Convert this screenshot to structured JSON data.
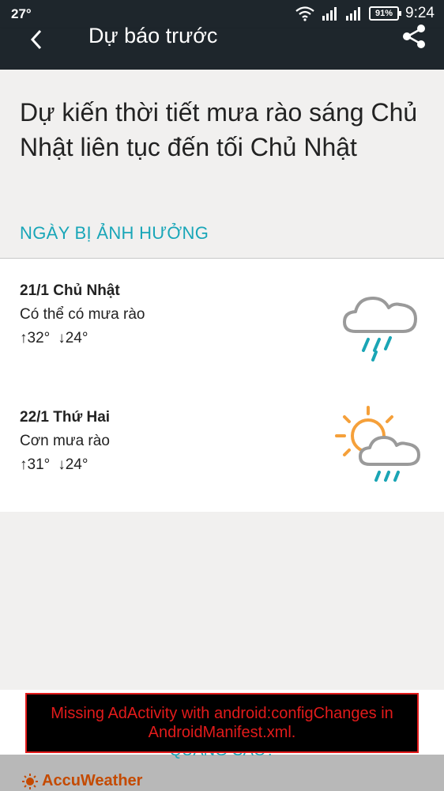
{
  "status_bar": {
    "temperature": "27°",
    "battery": "91%",
    "time": "9:24"
  },
  "app_bar": {
    "title": "Dự báo trước"
  },
  "alert": {
    "headline": "Dự kiến thời tiết mưa rào sáng Chủ Nhật liên tục đến tối Chủ Nhật",
    "section_label": "NGÀY BỊ ẢNH HƯỞNG"
  },
  "days": [
    {
      "date": "21/1 Chủ Nhật",
      "condition": "Có thể có mưa rào",
      "high": "↑32°",
      "low": "↓24°",
      "icon": "cloud-rain-icon"
    },
    {
      "date": "22/1 Thứ Hai",
      "condition": "Cơn mưa rào",
      "high": "↑31°",
      "low": "↓24°",
      "icon": "sun-cloud-rain-icon"
    }
  ],
  "ad": {
    "error_message": "Missing AdActivity with android:configChanges in AndroidManifest.xml.",
    "question": "QUẢNG CÁO?",
    "brand": "AccuWeather"
  },
  "colors": {
    "accent": "#19a6b8",
    "appbar": "#1e262c",
    "error": "#e21b1b",
    "sun": "#f5a03a",
    "rain": "#1aa5b5"
  }
}
